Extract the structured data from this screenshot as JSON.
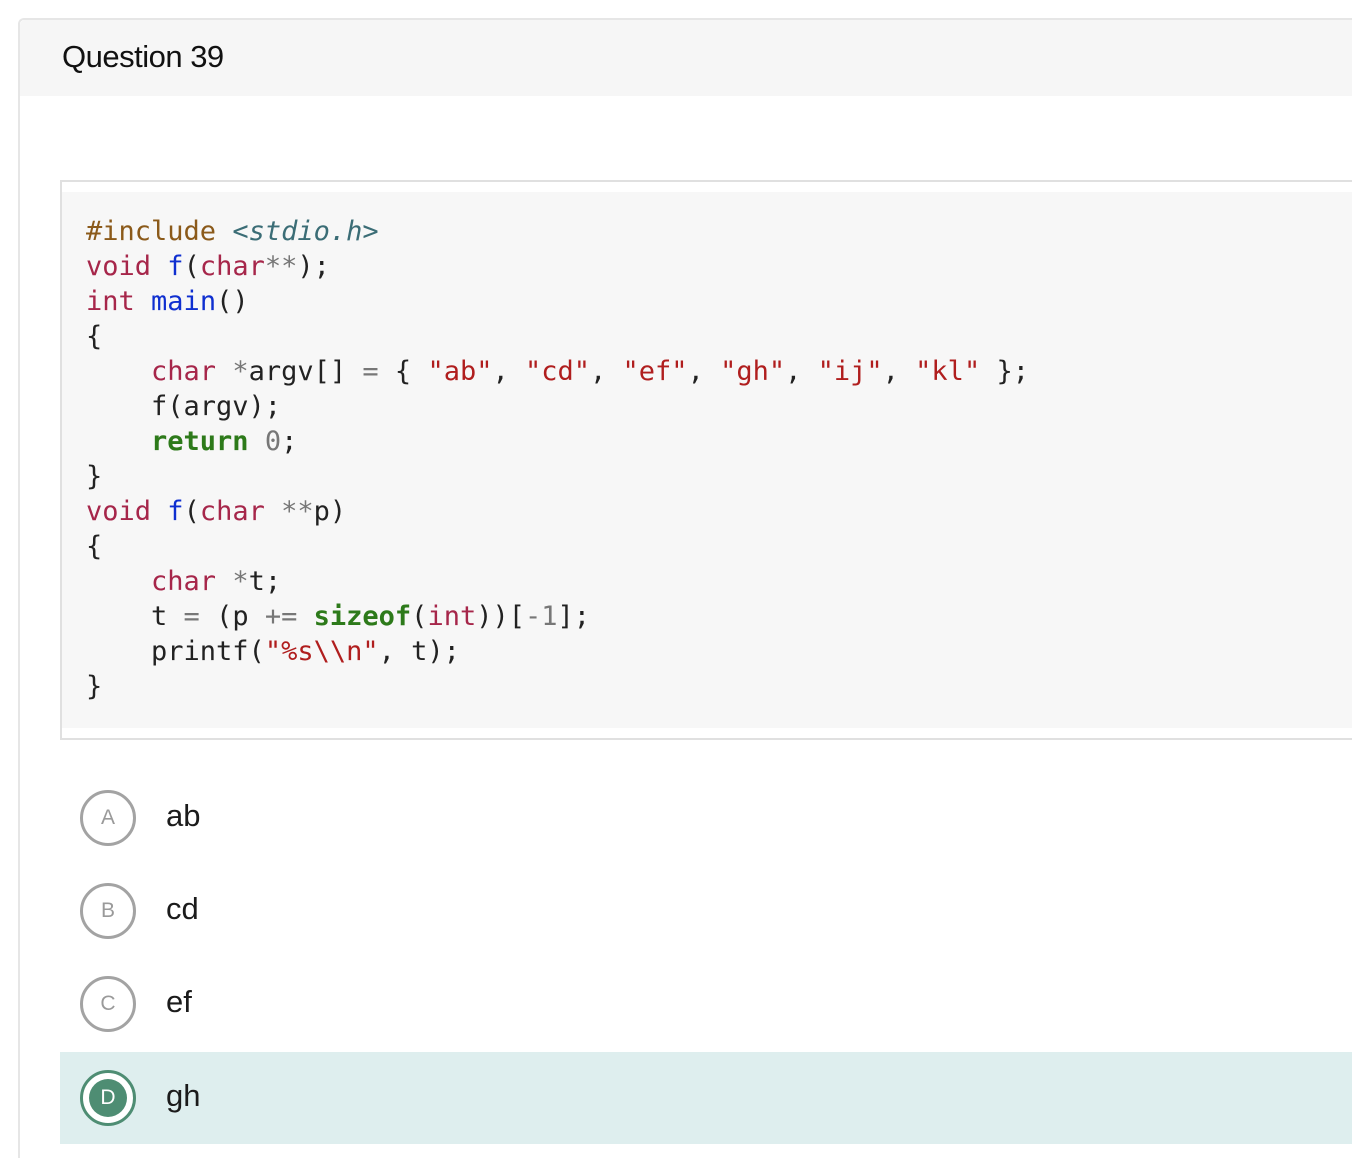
{
  "question": {
    "title": "Question 39"
  },
  "code": {
    "lines": [
      [
        {
          "t": "#include ",
          "c": "inc"
        },
        {
          "t": "<stdio.h>",
          "c": "hdr"
        }
      ],
      [
        {
          "t": "void",
          "c": "kw"
        },
        {
          "t": " "
        },
        {
          "t": "f",
          "c": "fn"
        },
        {
          "t": "("
        },
        {
          "t": "char",
          "c": "kw"
        },
        {
          "t": "**",
          "c": "op"
        },
        {
          "t": ");"
        }
      ],
      [
        {
          "t": "int",
          "c": "kw"
        },
        {
          "t": " "
        },
        {
          "t": "main",
          "c": "fn"
        },
        {
          "t": "()"
        }
      ],
      [
        {
          "t": "{"
        }
      ],
      [
        {
          "t": "    "
        },
        {
          "t": "char",
          "c": "kw"
        },
        {
          "t": " "
        },
        {
          "t": "*",
          "c": "op"
        },
        {
          "t": "argv[] "
        },
        {
          "t": "=",
          "c": "op"
        },
        {
          "t": " { "
        },
        {
          "t": "\"ab\"",
          "c": "str"
        },
        {
          "t": ", "
        },
        {
          "t": "\"cd\"",
          "c": "str"
        },
        {
          "t": ", "
        },
        {
          "t": "\"ef\"",
          "c": "str"
        },
        {
          "t": ", "
        },
        {
          "t": "\"gh\"",
          "c": "str"
        },
        {
          "t": ", "
        },
        {
          "t": "\"ij\"",
          "c": "str"
        },
        {
          "t": ", "
        },
        {
          "t": "\"kl\"",
          "c": "str"
        },
        {
          "t": " };"
        }
      ],
      [
        {
          "t": "    f(argv);"
        }
      ],
      [
        {
          "t": "    "
        },
        {
          "t": "return",
          "c": "ret"
        },
        {
          "t": " "
        },
        {
          "t": "0",
          "c": "num"
        },
        {
          "t": ";"
        }
      ],
      [
        {
          "t": "}"
        }
      ],
      [
        {
          "t": "void",
          "c": "kw"
        },
        {
          "t": " "
        },
        {
          "t": "f",
          "c": "fn"
        },
        {
          "t": "("
        },
        {
          "t": "char",
          "c": "kw"
        },
        {
          "t": " "
        },
        {
          "t": "**",
          "c": "op"
        },
        {
          "t": "p)"
        }
      ],
      [
        {
          "t": "{"
        }
      ],
      [
        {
          "t": "    "
        },
        {
          "t": "char",
          "c": "kw"
        },
        {
          "t": " "
        },
        {
          "t": "*",
          "c": "op"
        },
        {
          "t": "t;"
        }
      ],
      [
        {
          "t": "    t "
        },
        {
          "t": "=",
          "c": "op"
        },
        {
          "t": " (p "
        },
        {
          "t": "+=",
          "c": "op"
        },
        {
          "t": " "
        },
        {
          "t": "sizeof",
          "c": "ret"
        },
        {
          "t": "("
        },
        {
          "t": "int",
          "c": "kw"
        },
        {
          "t": "))["
        },
        {
          "t": "-",
          "c": "op"
        },
        {
          "t": "1",
          "c": "num"
        },
        {
          "t": "];"
        }
      ],
      [
        {
          "t": "    printf("
        },
        {
          "t": "\"%s\\\\n\"",
          "c": "str"
        },
        {
          "t": ", t);"
        }
      ],
      [
        {
          "t": "}"
        }
      ]
    ]
  },
  "options": [
    {
      "letter": "A",
      "text": "ab",
      "selected": false
    },
    {
      "letter": "B",
      "text": "cd",
      "selected": false
    },
    {
      "letter": "C",
      "text": "ef",
      "selected": false
    },
    {
      "letter": "D",
      "text": "gh",
      "selected": true
    }
  ],
  "colors": {
    "selected_bg": "#deeeee",
    "selected_accent": "#4e8d73",
    "header_bg": "#f6f6f6",
    "code_bg": "#f7f7f7"
  }
}
